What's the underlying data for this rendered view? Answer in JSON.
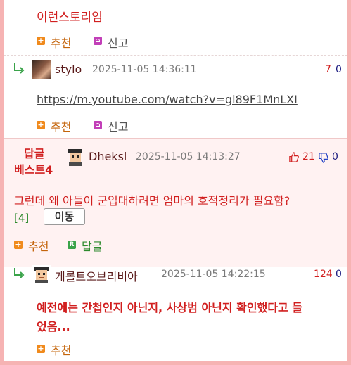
{
  "comments": [
    {
      "text": "이런스토리임",
      "actions": {
        "recommend": "추천",
        "report": "신고"
      }
    },
    {
      "username": "stylo",
      "timestamp": "2025-11-05 14:36:11",
      "up": "7",
      "down": "0",
      "text": "https://m.youtube.com/watch?v=gl89F1MnLXI",
      "actions": {
        "recommend": "추천",
        "report": "신고"
      }
    },
    {
      "badge_line1": "답글",
      "badge_line2": "베스트4",
      "username": "Dheksl",
      "timestamp": "2025-11-05 14:13:27",
      "up": "21",
      "down": "0",
      "text": "그런데 왜 아들이 군입대하려면 엄마의 호적정리가 필요함?",
      "reply_count": "[4]",
      "move_label": "이동",
      "actions": {
        "recommend": "추천",
        "reply": "답글"
      }
    },
    {
      "username": "게롤트오브리비아",
      "timestamp": "2025-11-05 14:22:15",
      "up": "124",
      "down": "0",
      "text_line1": "예전에는 간첩인지 아닌지, 사상범 아닌지 확인했다고 들",
      "text_line2": "었음...",
      "actions": {
        "recommend": "추천"
      }
    }
  ],
  "icons": {
    "reply_arrow": "reply-arrow-icon",
    "plus": "plus-box-icon",
    "report": "report-siren-icon",
    "reply": "r-box-icon",
    "thumbs_up": "thumbs-up-icon",
    "thumbs_down": "thumbs-down-icon"
  },
  "colors": {
    "accent_red": "#d11f1f",
    "border_pink": "#f6b3b3",
    "best_bg": "#fff2f2",
    "plus_orange": "#f08a1c",
    "report_magenta": "#c23fb8",
    "reply_green": "#3aa34a",
    "down_blue": "#1f3fc4"
  }
}
